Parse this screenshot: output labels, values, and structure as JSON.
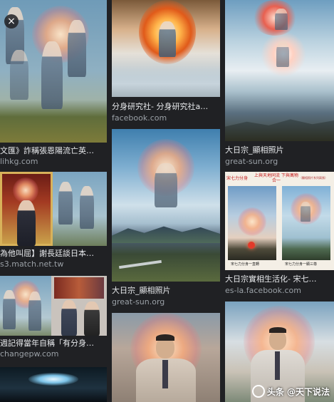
{
  "results": [
    {
      "caption": "文匯》詐稱張恩陽流亡英…",
      "source": "lihkg.com"
    },
    {
      "caption": "為他叫屈】謝長廷談日本…",
      "source": "s3.match.net.tw"
    },
    {
      "caption": "週記得當年自稱「有分身…",
      "source": "changepw.com"
    },
    {
      "caption": "分身研究社- 分身研究社a…",
      "source": "facebook.com"
    },
    {
      "caption": "大日宗_顯相照片",
      "source": "great-sun.org"
    },
    {
      "caption": "大日宗_顯相照片",
      "source": "great-sun.org"
    },
    {
      "caption": "大日宗實相生活化- 宋七…",
      "source": "es-la.facebook.com"
    }
  ],
  "poster": {
    "header_left": "宋七力分身",
    "header_mid": "上與天地同流 下與萬物合一",
    "header_right": "（顯相照片系列兩張）",
    "label_left": "宋七力分身一直轉",
    "label_right": "宋七力分身一顯三尊"
  },
  "close_icon": "×",
  "watermark": "头条 @天下说法"
}
